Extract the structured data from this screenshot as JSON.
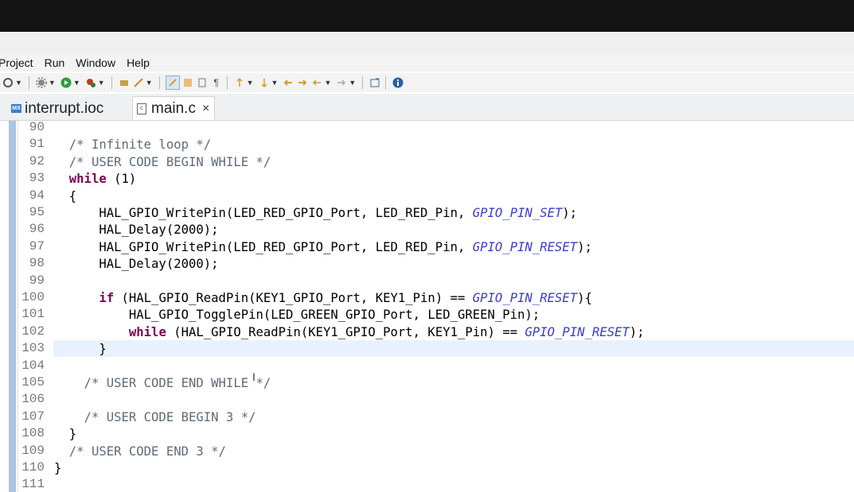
{
  "menu": [
    "Project",
    "Run",
    "Window",
    "Help"
  ],
  "toolbar_icons": [
    "settings-icon",
    "build-icon",
    "run-icon",
    "debug-icon",
    "tools-icon",
    "launch-icon",
    "edit-icon",
    "paint-icon",
    "book-icon",
    "pilcrow-icon",
    "prev-annotation-icon",
    "next-annotation-icon",
    "back-icon",
    "forward-icon",
    "nav-back-icon",
    "nav-forward-icon",
    "open-perspective-icon",
    "info-icon"
  ],
  "tabs": [
    {
      "label": "interrupt.ioc",
      "icon": "mx-icon"
    },
    {
      "label": "main.c",
      "icon": "c-file-icon",
      "close": "×"
    }
  ],
  "editor": {
    "lines": [
      {
        "num": "90",
        "code": ""
      },
      {
        "num": "91",
        "code": "  /* Infinite loop */"
      },
      {
        "num": "92",
        "code": "  /* USER CODE BEGIN WHILE */"
      },
      {
        "num": "93",
        "code": "  while (1)"
      },
      {
        "num": "94",
        "code": "  {"
      },
      {
        "num": "95",
        "code": "      HAL_GPIO_WritePin(LED_RED_GPIO_Port, LED_RED_Pin, GPIO_PIN_SET);"
      },
      {
        "num": "96",
        "code": "      HAL_Delay(2000);"
      },
      {
        "num": "97",
        "code": "      HAL_GPIO_WritePin(LED_RED_GPIO_Port, LED_RED_Pin, GPIO_PIN_RESET);"
      },
      {
        "num": "98",
        "code": "      HAL_Delay(2000);"
      },
      {
        "num": "99",
        "code": ""
      },
      {
        "num": "100",
        "code": "      if (HAL_GPIO_ReadPin(KEY1_GPIO_Port, KEY1_Pin) == GPIO_PIN_RESET){"
      },
      {
        "num": "101",
        "code": "          HAL_GPIO_TogglePin(LED_GREEN_GPIO_Port, LED_GREEN_Pin);"
      },
      {
        "num": "102",
        "code": "          while (HAL_GPIO_ReadPin(KEY1_GPIO_Port, KEY1_Pin) == GPIO_PIN_RESET);"
      },
      {
        "num": "103",
        "code": "      }"
      },
      {
        "num": "104",
        "code": ""
      },
      {
        "num": "105",
        "code": "    /* USER CODE END WHILE */"
      },
      {
        "num": "106",
        "code": ""
      },
      {
        "num": "107",
        "code": "    /* USER CODE BEGIN 3 */"
      },
      {
        "num": "108",
        "code": "  }"
      },
      {
        "num": "109",
        "code": "  /* USER CODE END 3 */"
      },
      {
        "num": "110",
        "code": "}"
      },
      {
        "num": "111",
        "code": ""
      }
    ]
  },
  "colors": {
    "keyword": "#7f0055",
    "macro": "#3b3bd1",
    "comment": "#5f6a7a",
    "current_line": "#e8f2fe"
  }
}
